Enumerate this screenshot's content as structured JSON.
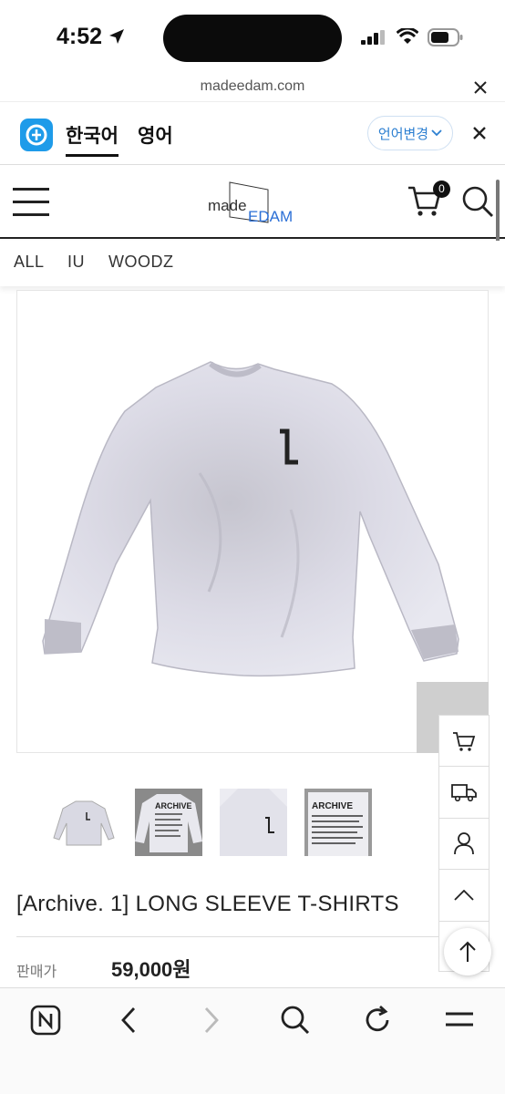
{
  "status_bar": {
    "time": "4:52"
  },
  "url_bar": {
    "url": "madeedam.com"
  },
  "language_bar": {
    "korean_label": "한국어",
    "english_label": "영어",
    "change_button": "언어변경"
  },
  "header": {
    "logo_made": "made",
    "logo_edam": "EDAM",
    "cart_count": "0"
  },
  "categories": [
    "ALL",
    "IU",
    "WOODZ"
  ],
  "thumbnails": [
    {
      "label": ""
    },
    {
      "label": "ARCHIVE"
    },
    {
      "label": ""
    },
    {
      "label": "ARCHIVE"
    }
  ],
  "product": {
    "title": "[Archive. 1] LONG SLEEVE T-SHIRTS",
    "price_label": "판매가",
    "price": "59,000원"
  },
  "colors": {
    "language_logo": "#1e9be9",
    "language_button_text": "#2c7fd1",
    "header_border": "#222222"
  },
  "icons": {
    "side_buttons": [
      "cart-icon",
      "truck-icon",
      "user-icon",
      "chevron-up-icon"
    ],
    "toolbar": [
      "naver-icon",
      "back-icon",
      "forward-icon",
      "search-icon",
      "reload-icon",
      "menu-icon"
    ]
  }
}
